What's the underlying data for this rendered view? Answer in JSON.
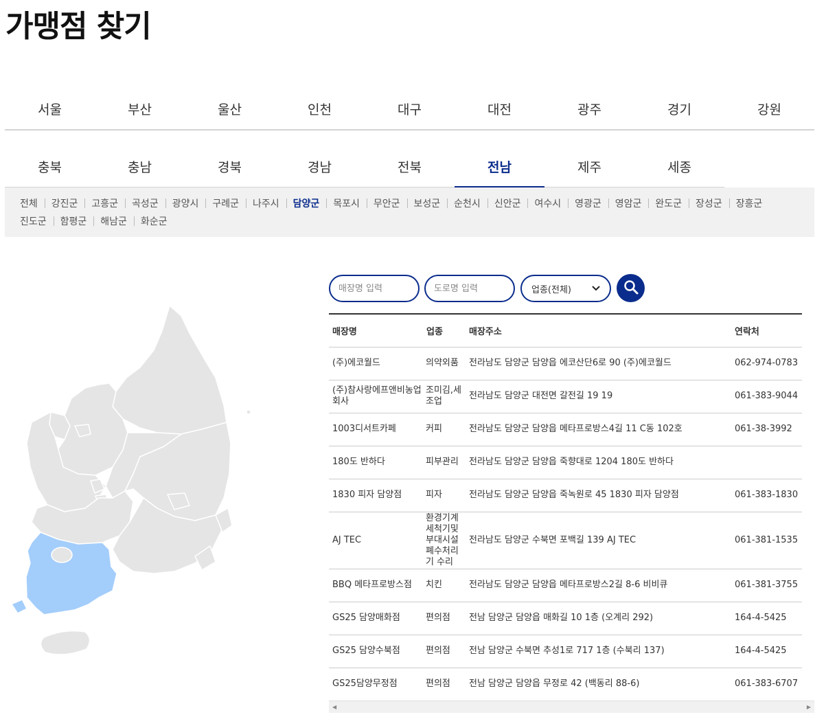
{
  "page_title": "가맹점 찾기",
  "regions_row1": [
    "서울",
    "부산",
    "울산",
    "인천",
    "대구",
    "대전",
    "광주",
    "경기",
    "강원"
  ],
  "regions_row2": [
    "충북",
    "충남",
    "경북",
    "경남",
    "전북",
    "전남",
    "제주",
    "세종"
  ],
  "active_region": "전남",
  "districts": [
    "전체",
    "강진군",
    "고흥군",
    "곡성군",
    "광양시",
    "구례군",
    "나주시",
    "담양군",
    "목포시",
    "무안군",
    "보성군",
    "순천시",
    "신안군",
    "여수시",
    "영광군",
    "영암군",
    "완도군",
    "장성군",
    "장흥군",
    "진도군",
    "함평군",
    "해남군",
    "화순군"
  ],
  "active_district": "담양군",
  "search": {
    "store_placeholder": "매장명 입력",
    "road_placeholder": "도로명 입력",
    "category_selected": "업종(전체)"
  },
  "table": {
    "headers": {
      "name": "매장명",
      "type": "업종",
      "address": "매장주소",
      "phone": "연락처"
    },
    "rows": [
      {
        "name": "(주)에코월드",
        "type": "의약외품",
        "address": "전라남도 담양군 담양읍 에코산단6로 90 (주)에코월드",
        "phone": "062-974-0783"
      },
      {
        "name": "(주)참사랑에프앤비농업회사",
        "type": "조미김,세조업",
        "address": "전라남도 담양군 대전면 갈전길 19 19",
        "phone": "061-383-9044"
      },
      {
        "name": "1003디서트카페",
        "type": "커피",
        "address": "전라남도 담양군 담양읍 메타프로방스4길 11 C동 102호",
        "phone": "061-38-3992"
      },
      {
        "name": "180도 반하다",
        "type": "피부관리",
        "address": "전라남도 담양군 담양읍 죽향대로 1204 180도 반하다",
        "phone": ""
      },
      {
        "name": "1830 피자 담양점",
        "type": "피자",
        "address": "전라남도 담양군 담양읍 죽녹원로 45 1830 피자 담양점",
        "phone": "061-383-1830"
      },
      {
        "name": "AJ TEC",
        "type": "환경기계세척기및부대시설폐수처리기 수리",
        "address": "전라남도 담양군 수북면 포백길 139 AJ TEC",
        "phone": "061-381-1535"
      },
      {
        "name": "BBQ 메타프로방스점",
        "type": "치킨",
        "address": "전라남도 담양군 담양읍 메타프로방스2길 8-6 비비큐",
        "phone": "061-381-3755"
      },
      {
        "name": "GS25 담양매화점",
        "type": "편의점",
        "address": "전남 담양군 담양읍 매화길 10 1층 (오계리 292)",
        "phone": "164-4-5425"
      },
      {
        "name": "GS25 담양수북점",
        "type": "편의점",
        "address": "전남 담양군 수북면 추성1로 717 1층 (수북리 137)",
        "phone": "164-4-5425"
      },
      {
        "name": "GS25담양무정점",
        "type": "편의점",
        "address": "전남 담양군 담양읍 무정로 42 (백동리 88-6)",
        "phone": "061-383-6707"
      }
    ]
  },
  "map": {
    "highlight_region": "전남",
    "highlight_color": "#a3cdfb",
    "base_color": "#e5e5e5"
  },
  "colors": {
    "accent": "#0a2c8c"
  },
  "icons": {
    "search": "search-icon",
    "dropdown": "chevron-down-icon"
  }
}
